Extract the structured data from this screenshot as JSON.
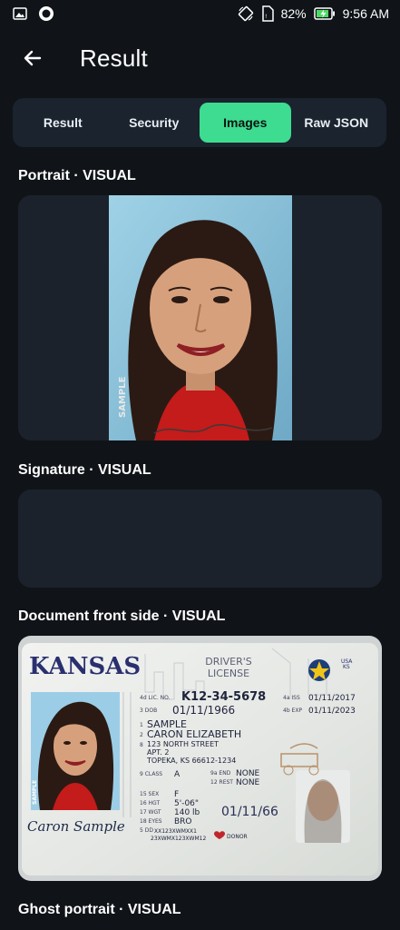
{
  "status": {
    "battery": "82%",
    "time": "9:56 AM"
  },
  "header": {
    "title": "Result"
  },
  "tabs": [
    {
      "label": "Result"
    },
    {
      "label": "Security"
    },
    {
      "label": "Images"
    },
    {
      "label": "Raw JSON"
    }
  ],
  "active_tab": "Images",
  "sections": [
    {
      "label": "Portrait · VISUAL"
    },
    {
      "label": "Signature · VISUAL"
    },
    {
      "label": "Document front side · VISUAL"
    },
    {
      "label": "Ghost portrait · VISUAL"
    }
  ],
  "portrait": {
    "watermark": "SAMPLE"
  },
  "license": {
    "state": "KANSAS",
    "type_line1": "DRIVER'S",
    "type_line2": "LICENSE",
    "usa": "USA",
    "ks": "KS",
    "lic_label": "4d LIC. NO.",
    "lic_no": "K12-34-5678",
    "iss_label": "4a ISS",
    "iss": "01/11/2017",
    "exp_label": "4b EXP",
    "exp": "01/11/2023",
    "dob_label": "3 DOB",
    "dob": "01/11/1966",
    "name_num1": "1",
    "last_name": "SAMPLE",
    "name_num2": "2",
    "first_name": "CARON ELIZABETH",
    "addr_num": "8",
    "addr1": "123 NORTH STREET",
    "addr2": "APT. 2",
    "addr3": "TOPEKA, KS 66612-1234",
    "class_label": "9 CLASS",
    "class": "A",
    "end_label": "9a END",
    "end": "NONE",
    "rest_label": "12 REST",
    "rest": "NONE",
    "sex_label": "15 SEX",
    "sex": "F",
    "hgt_label": "16 HGT",
    "hgt": "5'-06\"",
    "wgt_label": "17 WGT",
    "wgt": "140 lb",
    "eyes_label": "18 EYES",
    "eyes": "BRO",
    "dd_label": "5 DD",
    "dd1": "XX123XWMXX1",
    "dd2": "23XWMX123XWM12",
    "donor": "DONOR",
    "ghost_date": "01/11/66",
    "signature": "Caron Sample",
    "sample": "SAMPLE"
  }
}
